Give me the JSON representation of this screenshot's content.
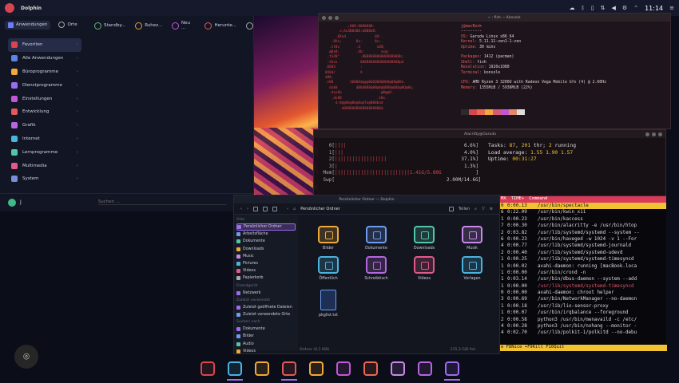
{
  "top_panel": {
    "app_title": "Dolphin",
    "clock": "11:14",
    "colors": {
      "bg": "#15192b"
    },
    "tray_icons": [
      "cloud-icon",
      "bluetooth-icon",
      "battery-icon",
      "network-icon",
      "volume-icon",
      "settings-icon",
      "chevron-up-icon"
    ]
  },
  "launcher": {
    "tabs": [
      {
        "label": "Anwendungen"
      },
      {
        "label": "Orte"
      }
    ],
    "quick": [
      {
        "label": "Standby..."
      },
      {
        "label": "Ruhez..."
      },
      {
        "label": "Neu ..."
      },
      {
        "label": "Herunte..."
      }
    ],
    "categories": [
      {
        "label": "Favoriten",
        "color": "#d8454f"
      },
      {
        "label": "Alle Anwendungen",
        "color": "#5a86e8"
      },
      {
        "label": "Büroprogramme",
        "color": "#f0a93a"
      },
      {
        "label": "Dienstprogramme",
        "color": "#9b6cf0"
      },
      {
        "label": "Einstellungen",
        "color": "#c257d6"
      },
      {
        "label": "Entwicklung",
        "color": "#e05a5a"
      },
      {
        "label": "Grafik",
        "color": "#b467e0"
      },
      {
        "label": "Internet",
        "color": "#4ab3e0"
      },
      {
        "label": "Lernprogramme",
        "color": "#52c7a8"
      },
      {
        "label": "Multimedia",
        "color": "#e05a8a"
      },
      {
        "label": "System",
        "color": "#7a8cd8"
      }
    ],
    "search_placeholder": "Suchen ...",
    "user_initial": "J"
  },
  "konsole": {
    "title": "~ : fish — Konsole",
    "art": "          .;888:8888888:\n       x;XxXB8X8B:b8B8d8:\n     .8Xxd              8X:.\n   .8Xx;       8x:      8x:.\n  .tt8x        .d        x88;\n .@8x8;        .db:        xx@;\n ,tSX8°          .888888888888888888b;\n .SSxx           8888888888888888888pd\n.688X            :\n8X8d/            X\nd88.\n.t88        S8888d@@@8QQQ88Q8Q8@Q8@88x.\n  dx8d         dB8d8B8@88@8@Q8B8@Q8b@8Q@8q.\n  .dxx8o                  .@8@@8.\n   .dx88                 .t8x.\n     d:8@@8b@8b@8a@7a@8B8bod\n       .d888888888888888888d.",
    "host": "j@macBook",
    "separator": "---------",
    "fields": [
      {
        "k": "OS:",
        "v": "Garuda Linux x86_64"
      },
      {
        "k": "Kernel:",
        "v": "5.11.11-zen1-1-zen"
      },
      {
        "k": "Uptime:",
        "v": "30 mins"
      },
      {
        "k": "Packages:",
        "v": "1412 (pacman)"
      },
      {
        "k": "Shell:",
        "v": "fish"
      },
      {
        "k": "Resolution:",
        "v": "1920x1080"
      },
      {
        "k": "Terminal:",
        "v": "konsole"
      },
      {
        "k": "CPU:",
        "v": "AMD Ryzen 3 3200U with Radeon Vega Mobile Gfx (4) @ 2.60Hz"
      },
      {
        "k": "Memory:",
        "v": "1355MiB / 5936MiB (22%)"
      }
    ],
    "palette": [
      "#2b2b2b",
      "#d8454f",
      "#e86a50",
      "#f0a93a",
      "#d85a7a",
      "#c257d6",
      "#e08a6a",
      "#dddddd"
    ]
  },
  "alacritty": {
    "title": "Alacritty@Garuda",
    "bars": [
      {
        "n": "0[",
        "b": "||||",
        "v": "6.6%]"
      },
      {
        "n": "1[",
        "b": "|||",
        "v": "4.0%]"
      },
      {
        "n": "2[",
        "b": "||||||||||||||||||",
        "v": "37.1%]"
      },
      {
        "n": "3[",
        "b": "|",
        "v": "1.3%]"
      },
      {
        "n": "Mem[",
        "b": "||||||||||||||||||||||||||1.41G/5.80G",
        "v": "]"
      },
      {
        "n": "Swp[",
        "b": "",
        "v": "2.00M/14.6G]"
      }
    ],
    "tasks_label": "Tasks:",
    "tasks": "87",
    "thr": "201",
    "thr_label": "thr;",
    "running": "2",
    "running_label": "running",
    "load_label": "Load average:",
    "load1": "1.55",
    "load2": "1.90",
    "load3": "1.57",
    "uptime_label": "Uptime:",
    "uptime": "00:31:27"
  },
  "process_list": {
    "headers": [
      "MX",
      "TIME+",
      "Command"
    ],
    "rows": [
      {
        "p": "0",
        "t": "0:00.13",
        "c": "/usr/bin/spectacle",
        "sel": true
      },
      {
        "p": "6",
        "t": "0:22.09",
        "c": "/usr/bin/kwin_x11"
      },
      {
        "p": "1",
        "t": "0:00.23",
        "c": "/usr/bin/kaccess"
      },
      {
        "p": "7",
        "t": "0:00.30",
        "c": "/usr/bin/alacritty -e /usr/bin/htop"
      },
      {
        "p": "2",
        "t": "0:03.82",
        "c": "/usr/lib/systemd/systemd --system --"
      },
      {
        "p": "6",
        "t": "0:00.23",
        "c": "/usr/bin/haveged -w 1024 -v 1 --For"
      },
      {
        "p": "4",
        "t": "0:00.77",
        "c": "/usr/lib/systemd/systemd-journald"
      },
      {
        "p": "2",
        "t": "0:00.40",
        "c": "/usr/lib/systemd/systemd-udevd"
      },
      {
        "p": "1",
        "t": "0:00.25",
        "c": "/usr/lib/systemd/systemd-timesyncd"
      },
      {
        "p": "1",
        "t": "0:00.02",
        "c": "avahi-daemon: running [macBook.loca"
      },
      {
        "p": "1",
        "t": "0:00.00",
        "c": "/usr/bin/crond -n"
      },
      {
        "p": "1",
        "t": "0:03.14",
        "c": "/usr/bin/dbus-daemon --system --add"
      },
      {
        "p": "1",
        "t": "0:00.00",
        "c": "/usr/lib/systemd/systemd-timesyncd",
        "red": true
      },
      {
        "p": "0",
        "t": "0:00.00",
        "c": "avahi-daemon: chroot helper"
      },
      {
        "p": "3",
        "t": "0:00.69",
        "c": "/usr/bin/NetworkManager --no-daemon"
      },
      {
        "p": "1",
        "t": "0:00.18",
        "c": "/usr/lib/lio-sensor-proxy"
      },
      {
        "p": "1",
        "t": "0:00.07",
        "c": "/usr/bin/irqbalance --foreground"
      },
      {
        "p": "2",
        "t": "0:00.58",
        "c": "python3 /usr/bin/menavaild -c /etc/"
      },
      {
        "p": "4",
        "t": "0:00.28",
        "c": "python3 /usr/bin/nohang --monitor -"
      },
      {
        "p": "4",
        "t": "0:02.70",
        "c": "/usr/lib/polkit-1/polkitd --no-debu"
      }
    ],
    "footer": "e F8Nice +F9Kill  F10Quit"
  },
  "dolphin": {
    "title": "Persönlicher Ordner — Dolphin",
    "breadcrumb": "Persönlicher Ordner",
    "split_label": "Teilen",
    "sidebar": {
      "orte_header": "Orte",
      "orte": [
        "Persönlicher Ordner",
        "Arbeitsfläche",
        "Dokumente",
        "Downloads",
        "Music",
        "Pictures",
        "Videos",
        "Papierkorb"
      ],
      "remote_header": "Fremdgerät",
      "remote": [
        "Netzwerk"
      ],
      "recent_header": "Zuletzt verwendet",
      "recent": [
        "Zuletzt geöffnete Dateien",
        "Zuletzt verwendete Orte"
      ],
      "search_header": "Suchen nach",
      "search": [
        "Dokumente",
        "Bilder",
        "Audio",
        "Videos"
      ]
    },
    "folders": [
      {
        "label": "Bilder",
        "color": "#f0a93a"
      },
      {
        "label": "Dokumente",
        "color": "#6d9bf0"
      },
      {
        "label": "Downloads",
        "color": "#52c7a8"
      },
      {
        "label": "Musik",
        "color": "#c88ae8"
      },
      {
        "label": "Öffentlich",
        "color": "#4ab3e0"
      },
      {
        "label": "Schreibtisch",
        "color": "#b467e0"
      },
      {
        "label": "Videos",
        "color": "#e05a8a"
      },
      {
        "label": "Vorlagen",
        "color": "#4ab3e0"
      }
    ],
    "file": {
      "label": "pkglist.txt"
    },
    "status": "Ordner (0,1 KiB)",
    "free": "215,3 GiB frei"
  },
  "dock": {
    "items": [
      {
        "name": "garuda-dragon-icon",
        "color": "#d8454f"
      },
      {
        "name": "terminal-icon",
        "color": "#4ab3e0",
        "active": true
      },
      {
        "name": "firefox-icon",
        "color": "#f0a93a"
      },
      {
        "name": "folder-icon",
        "color": "#e05a5a",
        "active": true
      },
      {
        "name": "text-editor-icon",
        "color": "#f0a93a"
      },
      {
        "name": "settings-icon",
        "color": "#c257d6"
      },
      {
        "name": "system-monitor-icon",
        "color": "#e86a50"
      },
      {
        "name": "package-manager-icon",
        "color": "#c88ae8"
      },
      {
        "name": "hardware-icon",
        "color": "#b467e0"
      },
      {
        "name": "screenshot-tool-icon",
        "color": "#9b6cf0",
        "active": true
      }
    ]
  }
}
